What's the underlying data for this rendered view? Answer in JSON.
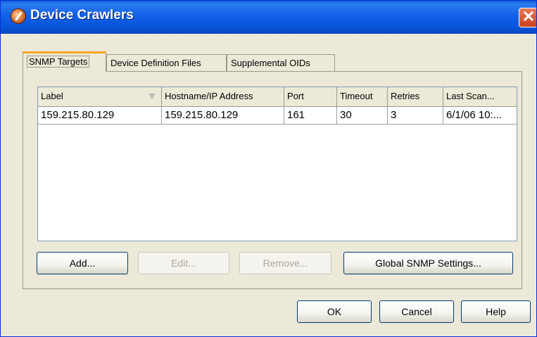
{
  "window": {
    "title": "Device Crawlers"
  },
  "tabs": [
    {
      "label": "SNMP Targets"
    },
    {
      "label": "Device Definition Files"
    },
    {
      "label": "Supplemental OIDs"
    }
  ],
  "table": {
    "columns": [
      "Label",
      "Hostname/IP Address",
      "Port",
      "Timeout",
      "Retries",
      "Last Scan..."
    ],
    "rows": [
      [
        "159.215.80.129",
        "159.215.80.129",
        "161",
        "30",
        "3",
        "6/1/06 10:..."
      ]
    ]
  },
  "buttons": {
    "add": "Add...",
    "edit": "Edit...",
    "remove": "Remove...",
    "global": "Global SNMP Settings...",
    "ok": "OK",
    "cancel": "Cancel",
    "help": "Help"
  }
}
